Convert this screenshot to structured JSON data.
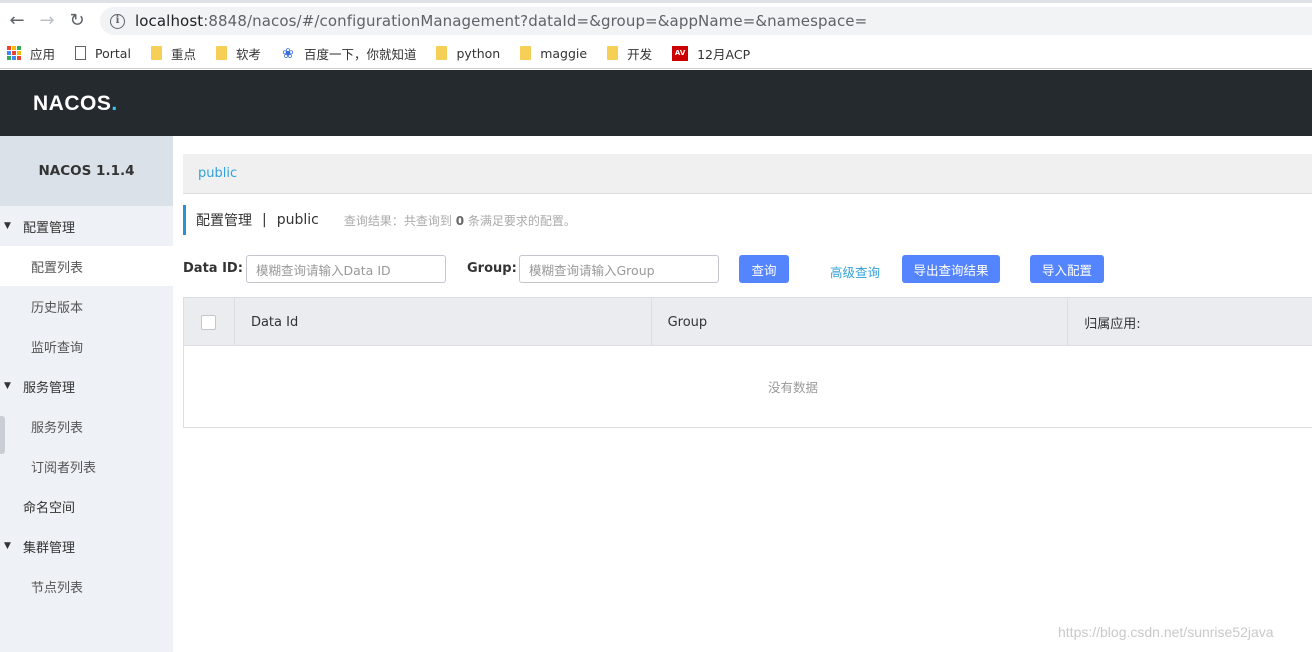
{
  "browser": {
    "url_host": "localhost",
    "url_rest": ":8848/nacos/#/configurationManagement?dataId=&group=&appName=&namespace=",
    "bookmarks": [
      {
        "label": "应用",
        "icon": "apps-icon"
      },
      {
        "label": "Portal",
        "icon": "page-icon"
      },
      {
        "label": "重点",
        "icon": "folder-icon"
      },
      {
        "label": "软考",
        "icon": "folder-icon"
      },
      {
        "label": "百度一下，你就知道",
        "icon": "baidu-paw-icon"
      },
      {
        "label": "python",
        "icon": "folder-icon"
      },
      {
        "label": "maggie",
        "icon": "folder-icon"
      },
      {
        "label": "开发",
        "icon": "folder-icon"
      },
      {
        "label": "12月ACP",
        "icon": "av-icon"
      }
    ]
  },
  "header": {
    "logo_main": "NACOS",
    "logo_dot": "."
  },
  "sidebar": {
    "title": "NACOS 1.1.4",
    "groups": {
      "config": "配置管理",
      "config_list": "配置列表",
      "history": "历史版本",
      "listen": "监听查询",
      "service": "服务管理",
      "service_list": "服务列表",
      "subscribers": "订阅者列表",
      "namespace": "命名空间",
      "cluster": "集群管理",
      "nodes": "节点列表"
    }
  },
  "main": {
    "namespace_tab": "public",
    "page_title": "配置管理",
    "separator": "|",
    "namespace": "public",
    "result_prefix": "查询结果：共查询到",
    "result_count": "0",
    "result_suffix": "条满足要求的配置。",
    "filters": {
      "dataid_label": "Data ID:",
      "dataid_placeholder": "模糊查询请输入Data ID",
      "group_label": "Group:",
      "group_placeholder": "模糊查询请输入Group",
      "search_button": "查询",
      "advanced_link": "高级查询",
      "export_button": "导出查询结果",
      "import_button": "导入配置"
    },
    "table": {
      "columns": [
        "Data Id",
        "Group",
        "归属应用:"
      ],
      "empty_text": "没有数据"
    }
  },
  "watermark": "https://blog.csdn.net/sunrise52java"
}
